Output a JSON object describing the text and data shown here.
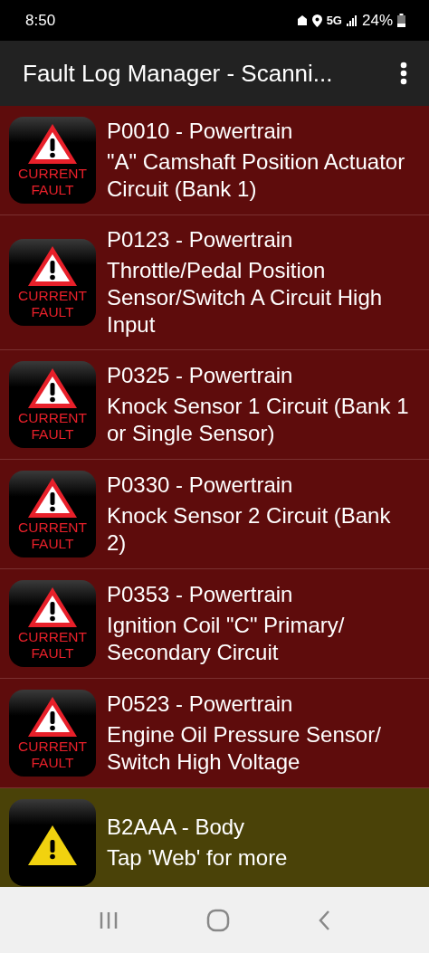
{
  "status_bar": {
    "time": "8:50",
    "network": "5G",
    "battery": "24%"
  },
  "app_bar": {
    "title": "Fault Log Manager - Scanni..."
  },
  "faults": [
    {
      "kind": "current",
      "badge_line_1": "CURRENT",
      "badge_line_2": "FAULT",
      "code": "P0010 - Powertrain",
      "description": "\"A\" Camshaft Position Actuator Circuit (Bank 1)"
    },
    {
      "kind": "current",
      "badge_line_1": "CURRENT",
      "badge_line_2": "FAULT",
      "code": "P0123 - Powertrain",
      "description": "Throttle/Pedal Position Sensor/Switch A Circuit High Input"
    },
    {
      "kind": "current",
      "badge_line_1": "CURRENT",
      "badge_line_2": "FAULT",
      "code": "P0325 - Powertrain",
      "description": "Knock Sensor 1 Circuit (Bank 1 or Single Sensor)"
    },
    {
      "kind": "current",
      "badge_line_1": "CURRENT",
      "badge_line_2": "FAULT",
      "code": "P0330 - Powertrain",
      "description": "Knock Sensor 2 Circuit (Bank 2)"
    },
    {
      "kind": "current",
      "badge_line_1": "CURRENT",
      "badge_line_2": "FAULT",
      "code": "P0353 - Powertrain",
      "description": "Ignition Coil \"C\" Primary/ Secondary Circuit"
    },
    {
      "kind": "current",
      "badge_line_1": "CURRENT",
      "badge_line_2": "FAULT",
      "code": "P0523 - Powertrain",
      "description": "Engine Oil Pressure Sensor/ Switch High Voltage"
    },
    {
      "kind": "warning",
      "code": "B2AAA - Body",
      "description": "Tap 'Web' for more"
    }
  ]
}
